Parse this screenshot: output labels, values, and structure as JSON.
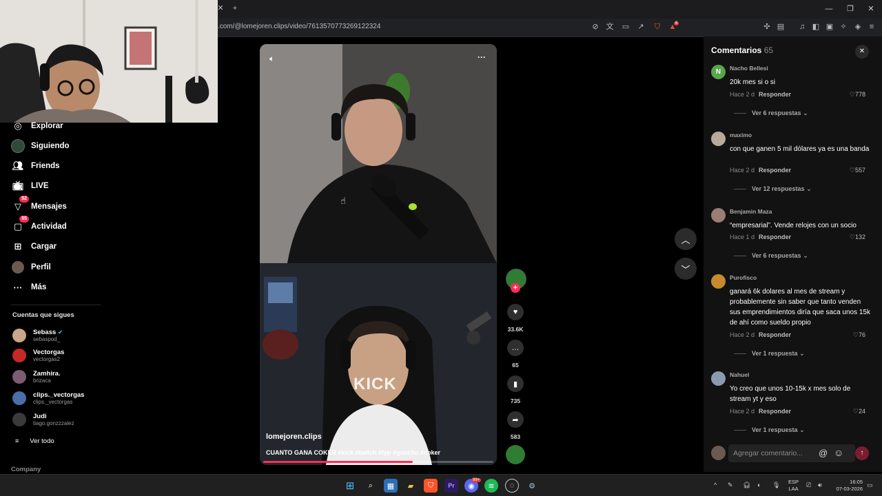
{
  "browser": {
    "url": ".com/@lomejoren.clips/video/7613570773269122324",
    "new_tab": "+",
    "ext_badge": "6"
  },
  "sidebar": {
    "items": [
      {
        "label": "Explorar",
        "icon": "compass-icon"
      },
      {
        "label": "Siguiendo",
        "icon": "following-avatar-icon"
      },
      {
        "label": "Friends",
        "icon": "friends-icon"
      },
      {
        "label": "LIVE",
        "icon": "live-tv-icon"
      },
      {
        "label": "Mensajes",
        "icon": "messages-icon",
        "badge": "52"
      },
      {
        "label": "Actividad",
        "icon": "activity-icon",
        "badge": "55"
      },
      {
        "label": "Cargar",
        "icon": "upload-icon"
      },
      {
        "label": "Perfil",
        "icon": "profile-avatar-icon"
      },
      {
        "label": "Más",
        "icon": "more-dots-icon"
      }
    ],
    "following_title": "Cuentas que sigues",
    "accounts": [
      {
        "name": "Sebass",
        "handle": "sebaspod_",
        "color": "#c9a58a"
      },
      {
        "name": "Vectorgas",
        "handle": "vectorgas2",
        "color": "#c62828"
      },
      {
        "name": "Zamhira.",
        "handle": "brizaca",
        "color": "#7b5c72"
      },
      {
        "name": "clips._vectorgas",
        "handle": "clips._vectorgas",
        "color": "#4a6ea8"
      },
      {
        "name": "Judi",
        "handle": "tiago.gonzzzalez",
        "color": "#3a3a3a"
      }
    ],
    "see_all": "Ver todo",
    "footer": "Company"
  },
  "video": {
    "author": "lomejoren.clips",
    "caption": "CUANTO GANA COKER #kick #twitch #fyp #goncho #coker",
    "kick_overlay": "KICK",
    "progress": 0.65
  },
  "actions": {
    "likes": "33.6K",
    "comments": "65",
    "saves": "735",
    "shares": "583"
  },
  "comments_panel": {
    "title": "Comentarios",
    "count": "65",
    "input_placeholder": "Agregar comentario...",
    "reply_label": "Responder",
    "items": [
      {
        "user": "Nacho Bellesi",
        "text": "20k mes si o si",
        "time": "Hace 2 d",
        "likes": "778",
        "replies": "Ver 6 respuestas",
        "avatar": "N",
        "color": "#58a64a"
      },
      {
        "user": "maximo",
        "text": "con que ganen 5 mil dólares ya es una banda",
        "time": "Hace 2 d",
        "likes": "557",
        "replies": "Ver 12 respuestas",
        "avatar": "",
        "color": "#b9a99a"
      },
      {
        "user": "Benjamin Maza",
        "text": "“empresarial”. Vende relojes con un socio",
        "time": "Hace 1 d",
        "likes": "132",
        "replies": "Ver 6 respuestas",
        "avatar": "",
        "color": "#9a7d75"
      },
      {
        "user": "Purofisco",
        "text": "ganará 6k dolares al mes de stream y probablemente sin saber que tanto venden sus emprendimientos diría que saca unos 15k de ahí como sueldo propio",
        "time": "Hace 2 d",
        "likes": "76",
        "replies": "Ver 1 respuesta",
        "avatar": "",
        "color": "#c78a2e"
      },
      {
        "user": "Nahuel",
        "text": "Yo creo que unos 10-15k x mes solo de stream yt y eso",
        "time": "Hace 2 d",
        "likes": "24",
        "replies": "Ver 1 respuesta",
        "avatar": "",
        "color": "#8a9bb0"
      }
    ]
  },
  "taskbar": {
    "lang": "ESP",
    "lang2": "LAA",
    "time": "16:05",
    "date": "07-03-2026",
    "discord_badge": "99+"
  },
  "colors": {
    "accent": "#fe2c55",
    "panel": "#121212",
    "bg": "#000000"
  }
}
